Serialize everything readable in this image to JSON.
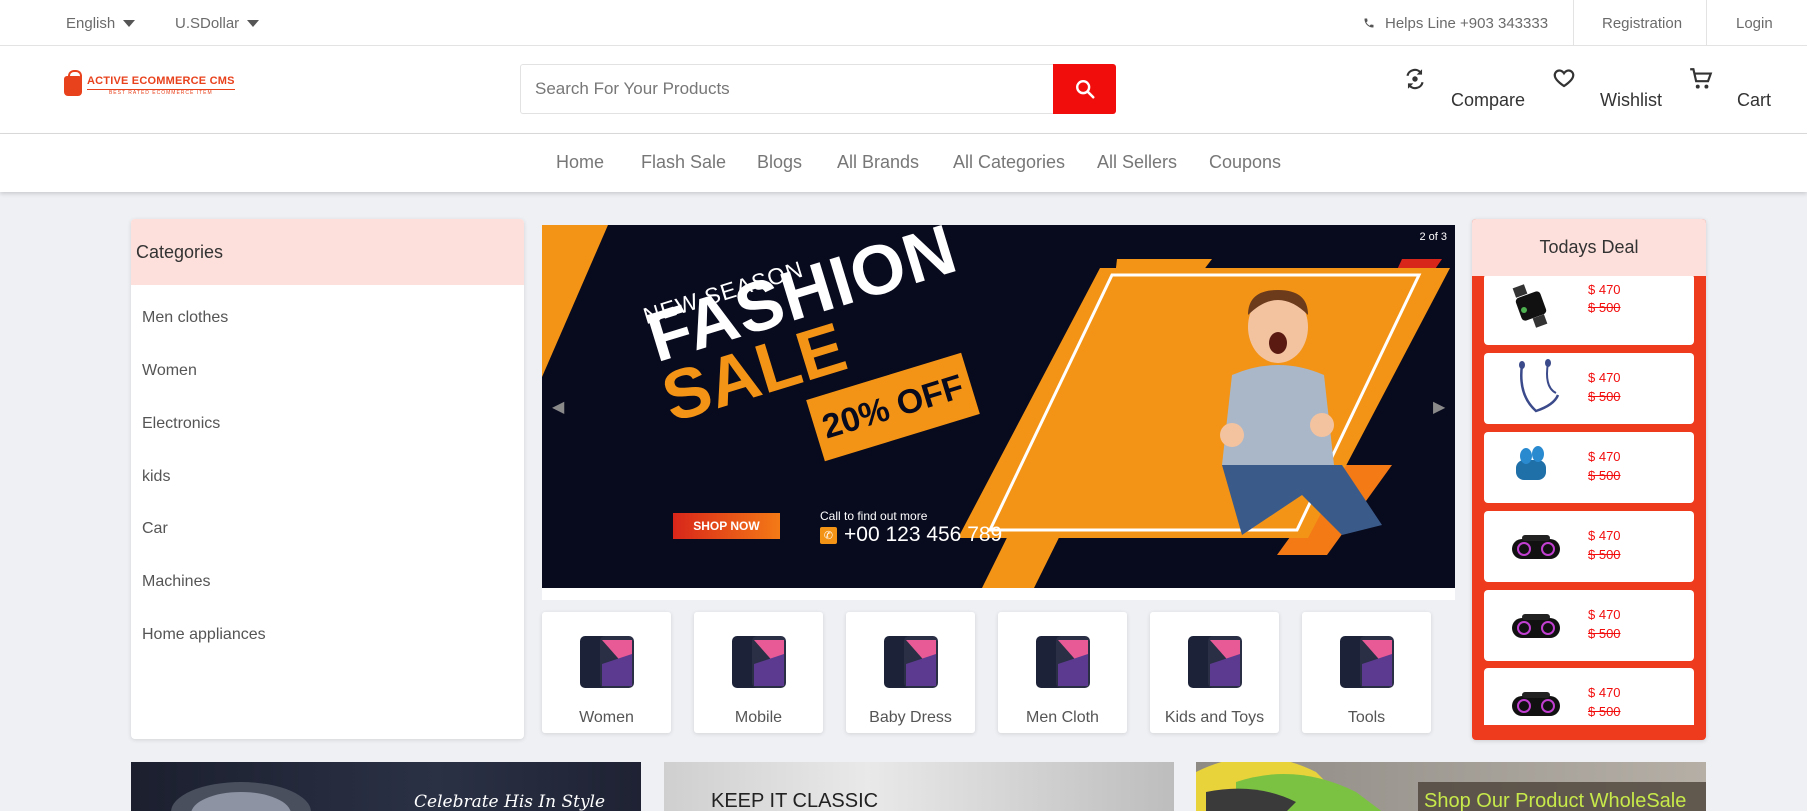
{
  "topbar": {
    "language": "English",
    "currency": "U.SDollar",
    "helpline": "Helps Line +903 343333",
    "registration": "Registration",
    "login": "Login"
  },
  "header": {
    "logo_text": "ACTIVE ECOMMERCE CMS",
    "logo_tagline": "BEST RATED ECOMMERCE ITEM",
    "search_placeholder": "Search For Your Products",
    "compare": "Compare",
    "wishlist": "Wishlist",
    "cart": "Cart"
  },
  "nav": {
    "items": [
      "Home",
      "Flash Sale",
      "Blogs",
      "All Brands",
      "All Categories",
      "All Sellers",
      "Coupons"
    ]
  },
  "categories": {
    "title": "Categories",
    "items": [
      "Men clothes",
      "Women",
      "Electronics",
      "kids",
      "Car",
      "Machines",
      "Home appliances"
    ]
  },
  "banner": {
    "counter": "2 of 3",
    "new_season": "NEW SEASON",
    "fashion": "FASHION",
    "sale": "SALE",
    "discount": "20% OFF",
    "shop_now": "SHOP NOW",
    "call_text": "Call to find out more",
    "phone": "+00 123 456 789"
  },
  "tiles": [
    "Women",
    "Mobile",
    "Baby Dress",
    "Men Cloth",
    "Kids and Toys",
    "Tools"
  ],
  "todays_deal": {
    "title": "Todays Deal",
    "items": [
      {
        "icon": "smartwatch",
        "price": "$ 470",
        "old_price": "$ 500"
      },
      {
        "icon": "earphones",
        "price": "$ 470",
        "old_price": "$ 500"
      },
      {
        "icon": "earbuds",
        "price": "$ 470",
        "old_price": "$ 500"
      },
      {
        "icon": "speaker",
        "price": "$ 470",
        "old_price": "$ 500"
      },
      {
        "icon": "speaker",
        "price": "$ 470",
        "old_price": "$ 500"
      },
      {
        "icon": "speaker",
        "price": "$ 470",
        "old_price": "$ 500"
      }
    ]
  },
  "promos": {
    "promo1": "Celebrate His In Style",
    "promo2": "KEEP IT CLASSIC",
    "promo3": "Shop Our Product WholeSale"
  },
  "colors": {
    "accent_red": "#f20d0d",
    "deal_red": "#ee3a1d",
    "pink_header": "#fde0dc",
    "banner_orange": "#f39416",
    "banner_navy": "#080a1e"
  }
}
